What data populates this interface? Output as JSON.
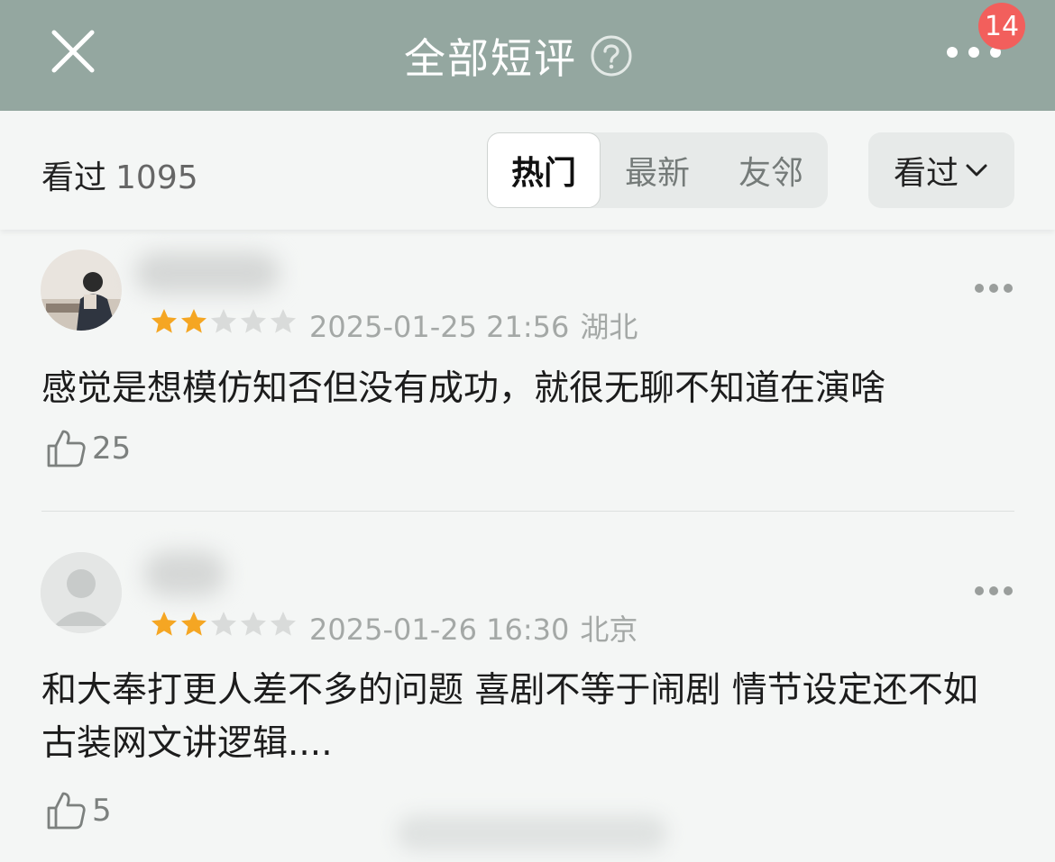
{
  "header": {
    "title": "全部短评",
    "close_icon": "close-icon",
    "help_icon": "question-circle-icon",
    "more_icon": "more-horizontal-icon",
    "notification_count": "14",
    "background": "#94a7a0"
  },
  "filter": {
    "watched_label": "看过",
    "watched_count": "1095",
    "tabs": [
      {
        "label": "热门",
        "active": true
      },
      {
        "label": "最新",
        "active": false
      },
      {
        "label": "友邻",
        "active": false
      }
    ],
    "dropdown_label": "看过"
  },
  "reviews": [
    {
      "rating": 2,
      "max_rating": 5,
      "date": "2025-01-25 21:56",
      "location": "湖北",
      "content": "感觉是想模仿知否但没有成功，就很无聊不知道在演啥",
      "likes": "25"
    },
    {
      "rating": 2,
      "max_rating": 5,
      "date": "2025-01-26 16:30",
      "location": "北京",
      "content": "和大奉打更人差不多的问题 喜剧不等于闹剧 情节设定还不如古装网文讲逻辑....",
      "likes": "5"
    }
  ],
  "colors": {
    "star_filled": "#f5a623",
    "star_empty": "#d9dbda",
    "badge": "#f25f5c"
  }
}
